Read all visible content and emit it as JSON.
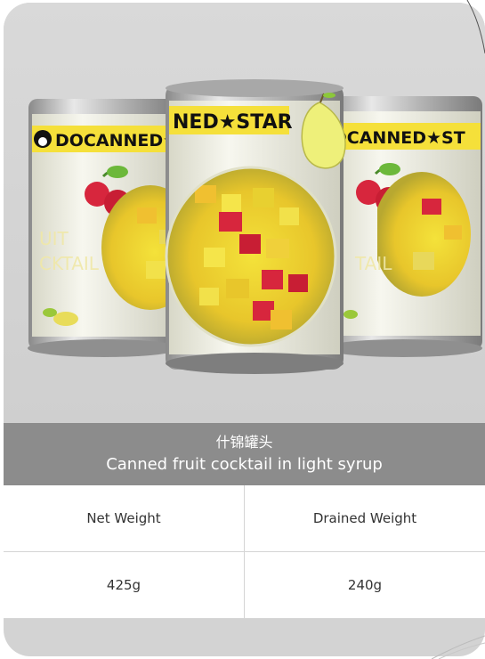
{
  "product": {
    "can_brand": "DOCANNED★STAR",
    "can_brand_left": "DOCANNED★",
    "can_brand_center": "NED★STAR",
    "can_brand_right": "DCANNED★ST",
    "can_label_left": "FRUIT COCKTAIL",
    "can_label_right": "TAIL",
    "title_cn": "什锦罐头",
    "title_en": "Canned fruit cocktail in light syrup"
  },
  "specs": {
    "headers": [
      "Net Weight",
      "Drained Weight"
    ],
    "values": [
      "425g",
      "240g"
    ]
  },
  "colors": {
    "card_bg": "#d3d3d3",
    "title_band": "#8c8c8c",
    "label_yellow": "#f5e03a",
    "fruit_red": "#d7263d"
  },
  "icons": [
    "penguin-logo-icon",
    "cherry-icon",
    "pear-icon"
  ]
}
